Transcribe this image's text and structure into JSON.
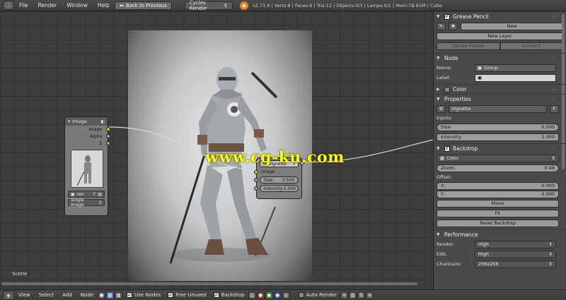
{
  "topbar": {
    "menus": [
      "File",
      "Render",
      "Window",
      "Help"
    ],
    "back_button": "Back to Previous",
    "render_engine": "Cycles Render",
    "stats": "v2.71.6 | Verts:8 | Faces:6 | Tris:12 | Objects:0/3 | Lamps:0/1 | Mem:78.61M | Cube"
  },
  "image_node": {
    "title": "Image",
    "outputs": [
      "Image",
      "Alpha",
      "Z"
    ],
    "image_name": "ren",
    "image_flag": "F",
    "source": "Single Image"
  },
  "vignette_node": {
    "group": "Vignette",
    "flag": "F",
    "input_label": "Image",
    "size_label": "Size:",
    "size_value": "0.500",
    "intensity_label": "Intensity:",
    "intensity_value": "1.000"
  },
  "watermark": "www.cg-ku.com",
  "scene_label": "Scene",
  "props": {
    "grease_pencil": {
      "title": "Grease Pencil",
      "new_label": "New",
      "new_layer_label": "New Layer",
      "delete_frame_label": "Delete Frame",
      "convert_label": "Convert"
    },
    "node": {
      "title": "Node",
      "name_label": "Name:",
      "name_value": "Group",
      "label_label": "Label:",
      "label_value": ""
    },
    "color_title": "Color",
    "properties": {
      "title": "Properties",
      "group_name": "Vignette",
      "group_flag": "F",
      "inputs_label": "Inputs:",
      "size_label": "Size:",
      "size_value": "0.500",
      "intensity_label": "Intensity:",
      "intensity_value": "1.000"
    },
    "backdrop": {
      "title": "Backdrop",
      "channel": "Color",
      "zoom_label": "Zoom:",
      "zoom_value": "0.48",
      "offset_label": "Offset:",
      "x_label": "X:",
      "x_value": "0.000",
      "y_label": "Y:",
      "y_value": "0.000",
      "move_label": "Move",
      "fit_label": "Fit",
      "reset_label": "Reset Backdrop"
    },
    "performance": {
      "title": "Performance",
      "render_label": "Render:",
      "render_value": "High",
      "edit_label": "Edit:",
      "edit_value": "High",
      "chunksize_label": "Chunksize:",
      "chunksize_value": "256x256"
    }
  },
  "bottombar": {
    "menus": [
      "View",
      "Select",
      "Add",
      "Node"
    ],
    "use_nodes": "Use Nodes",
    "free_unused": "Free Unused",
    "backdrop": "Backdrop",
    "auto_render": "Auto Render"
  },
  "colors": {
    "socket_image": "#c7c729",
    "socket_gray": "#a0a0a0",
    "accent_blue": "#5680c2",
    "watermark": "#ffff00"
  }
}
